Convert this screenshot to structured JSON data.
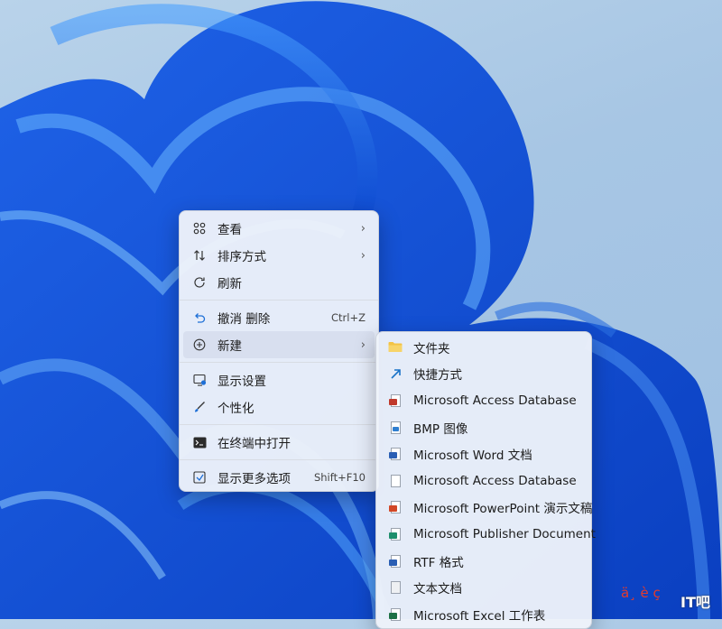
{
  "context_menu": {
    "items": [
      {
        "label": "查看",
        "icon": "view-grid-icon",
        "has_submenu": true
      },
      {
        "label": "排序方式",
        "icon": "sort-arrows-icon",
        "has_submenu": true
      },
      {
        "label": "刷新",
        "icon": "refresh-icon"
      },
      {
        "label": "撤消 删除",
        "icon": "undo-icon",
        "shortcut": "Ctrl+Z"
      },
      {
        "label": "新建",
        "icon": "new-plus-icon",
        "has_submenu": true
      },
      {
        "label": "显示设置",
        "icon": "display-settings-icon"
      },
      {
        "label": "个性化",
        "icon": "paintbrush-icon"
      },
      {
        "label": "在终端中打开",
        "icon": "terminal-icon"
      },
      {
        "label": "显示更多选项",
        "icon": "more-options-icon",
        "shortcut": "Shift+F10"
      }
    ],
    "chevron": "›"
  },
  "submenu": {
    "items": [
      {
        "label": "文件夹",
        "icon": "folder-icon",
        "color": "#f0c040"
      },
      {
        "label": "快捷方式",
        "icon": "shortcut-arrow-icon",
        "color": "#1a73c8"
      },
      {
        "label": "Microsoft Access Database",
        "icon": "access-file-icon",
        "color": "#c0392b"
      },
      {
        "label": "BMP 图像",
        "icon": "bmp-file-icon",
        "color": "#2f7fd0"
      },
      {
        "label": "Microsoft Word 文档",
        "icon": "word-file-icon",
        "color": "#2b5fb4"
      },
      {
        "label": "Microsoft Access Database",
        "icon": "blank-file-icon",
        "color": "#9aa2ae"
      },
      {
        "label": "Microsoft PowerPoint 演示文稿",
        "icon": "powerpoint-file-icon",
        "color": "#d24726"
      },
      {
        "label": "Microsoft Publisher Document",
        "icon": "publisher-file-icon",
        "color": "#1f8f6c"
      },
      {
        "label": "RTF 格式",
        "icon": "rtf-file-icon",
        "color": "#2b5fb4"
      },
      {
        "label": "文本文档",
        "icon": "text-file-icon",
        "color": "#9aa2ae"
      },
      {
        "label": "Microsoft Excel 工作表",
        "icon": "excel-file-icon",
        "color": "#1e7145"
      }
    ]
  },
  "watermark": {
    "text": "ä¸ è ç",
    "logo": "IT吧"
  }
}
